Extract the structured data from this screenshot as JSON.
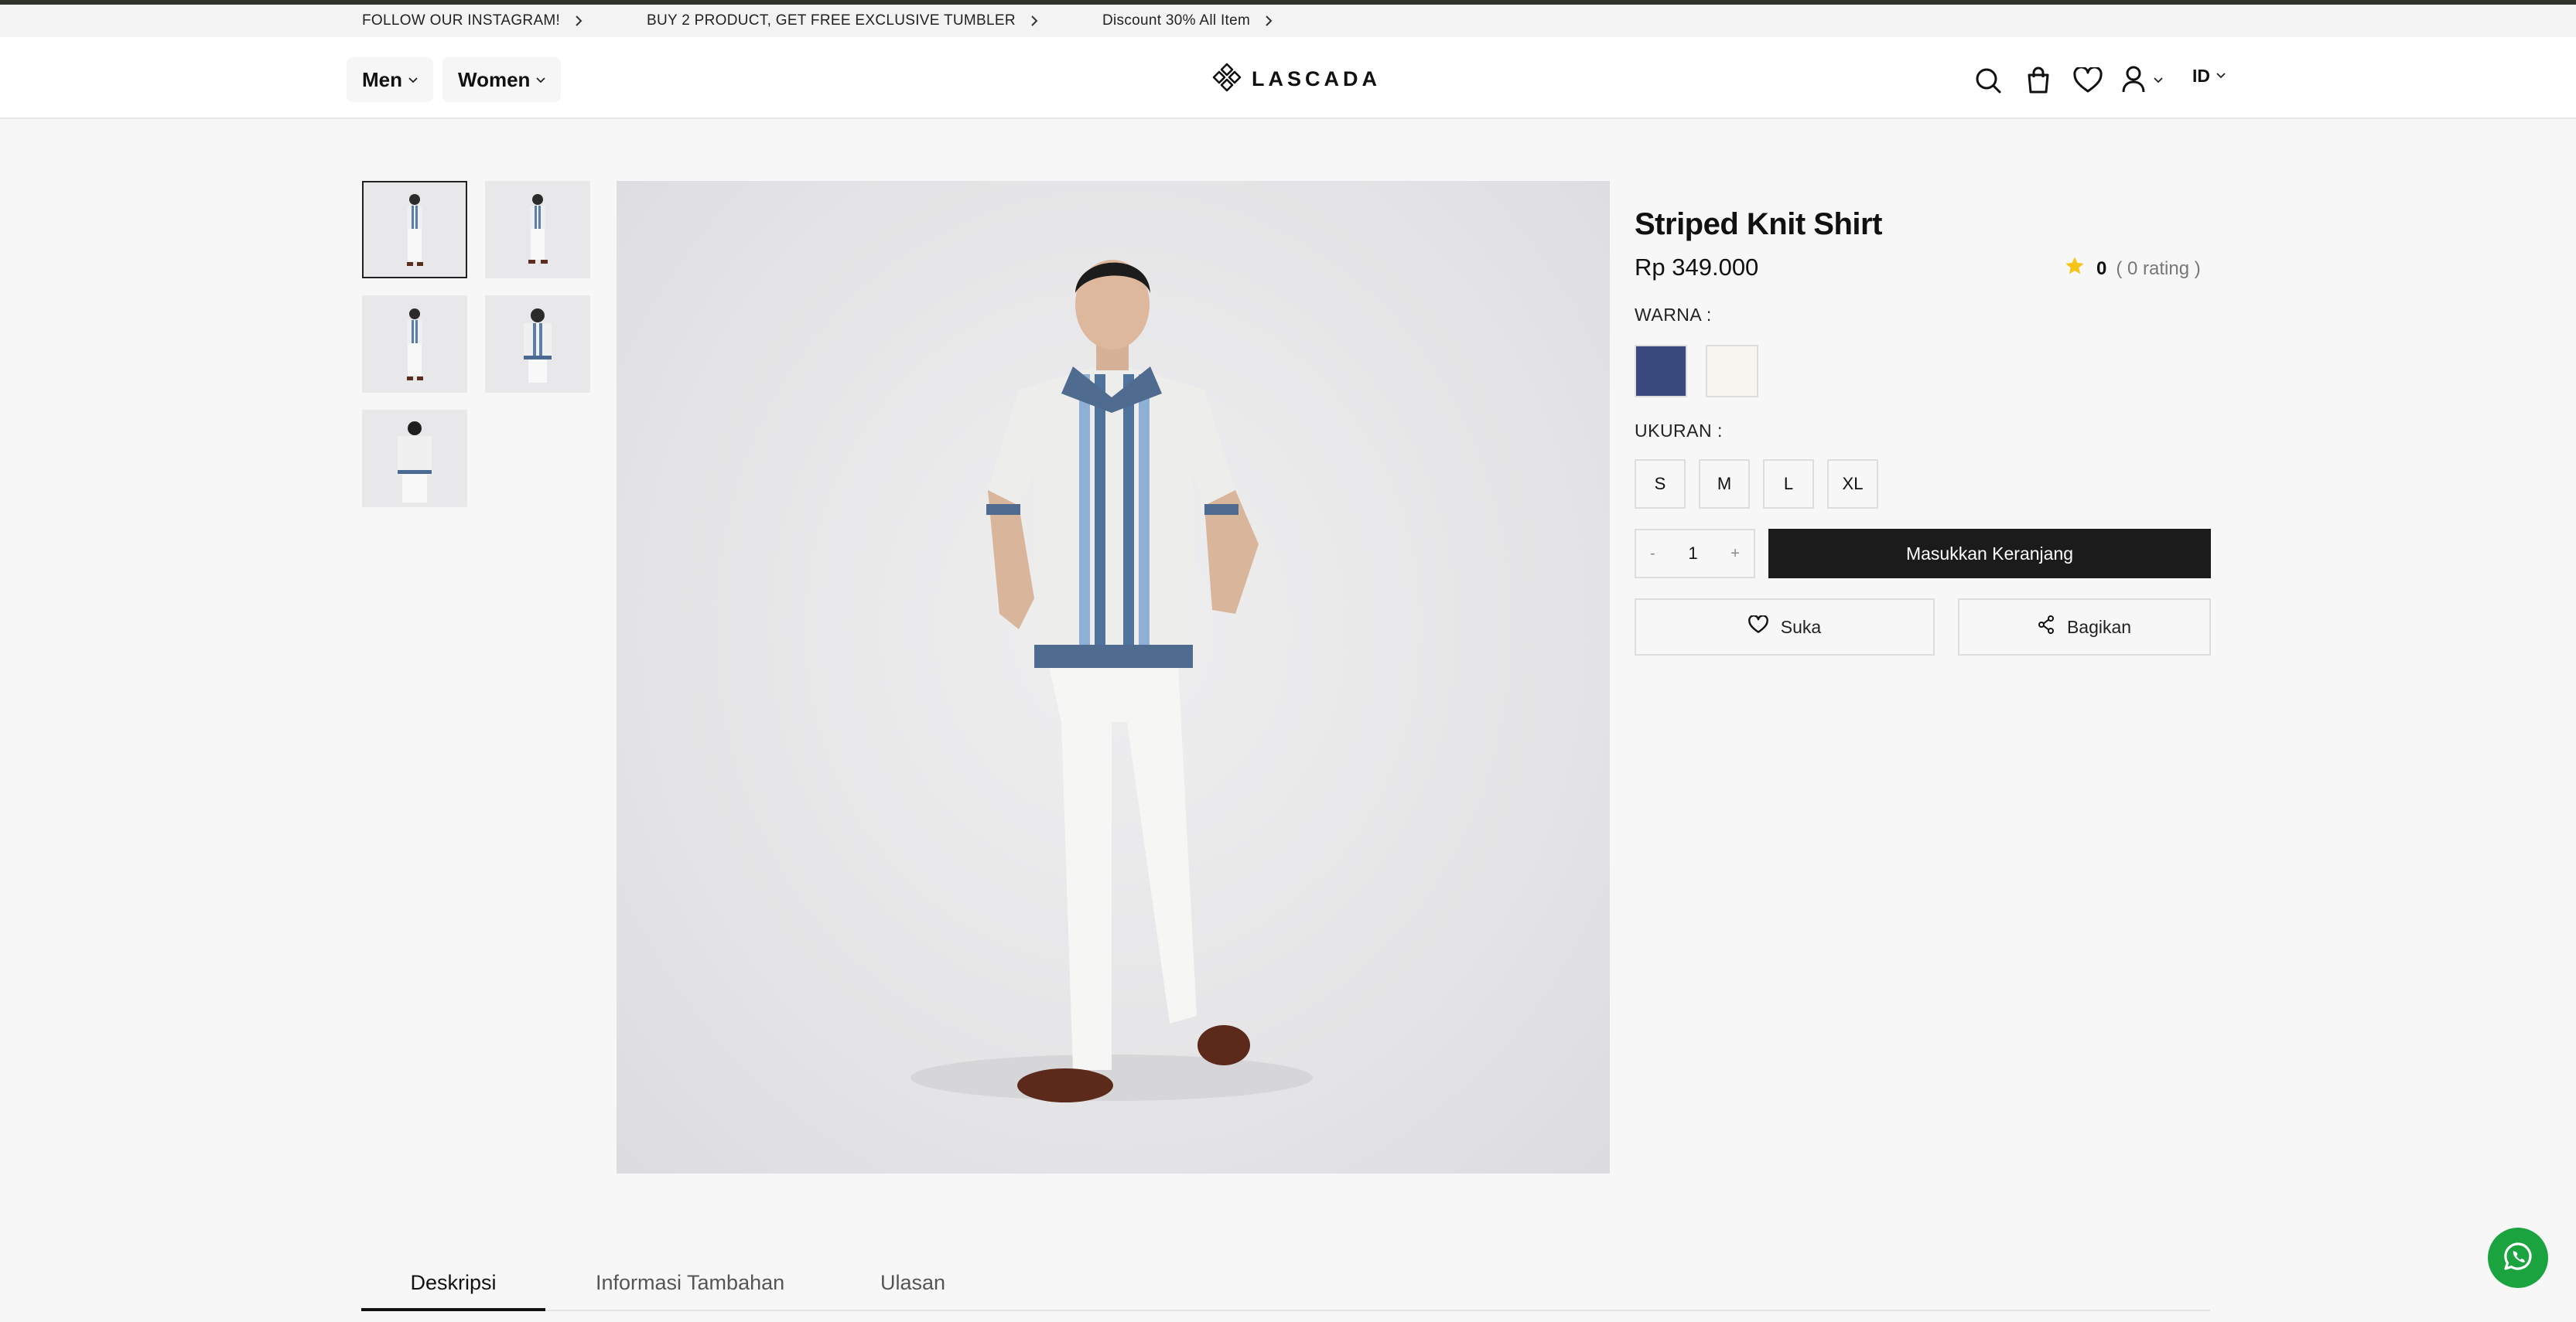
{
  "promo_bar": {
    "items": [
      {
        "label": "FOLLOW OUR INSTAGRAM!"
      },
      {
        "label": "BUY 2 PRODUCT, GET FREE EXCLUSIVE TUMBLER"
      },
      {
        "label": "Discount 30% All Item"
      }
    ]
  },
  "header": {
    "nav": [
      {
        "label": "Men"
      },
      {
        "label": "Women"
      }
    ],
    "logo_text": "LASCADA",
    "icons": [
      "search-icon",
      "bag-icon",
      "heart-icon",
      "user-icon"
    ],
    "language": "ID"
  },
  "product": {
    "name": "Striped Knit Shirt",
    "price": "Rp 349.000",
    "rating_value": "0",
    "rating_count": "( 0 rating )",
    "color_label": "WARNA :",
    "colors": [
      {
        "name": "navy",
        "hex": "#3a4a7e"
      },
      {
        "name": "cream",
        "hex": "#f7f5ef"
      }
    ],
    "size_label": "UKURAN :",
    "sizes": [
      "S",
      "M",
      "L",
      "XL"
    ],
    "quantity": "1",
    "qty_minus": "-",
    "qty_plus": "+",
    "add_to_cart": "Masukkan Keranjang",
    "like_label": "Suka",
    "share_label": "Bagikan"
  },
  "tabs": [
    {
      "label": "Deskripsi",
      "active": true
    },
    {
      "label": "Informasi Tambahan",
      "active": false
    },
    {
      "label": "Ulasan",
      "active": false
    }
  ],
  "colors": {
    "accent_dark": "#1b1b1b",
    "star": "#f5c518",
    "whatsapp": "#1aa33f"
  }
}
